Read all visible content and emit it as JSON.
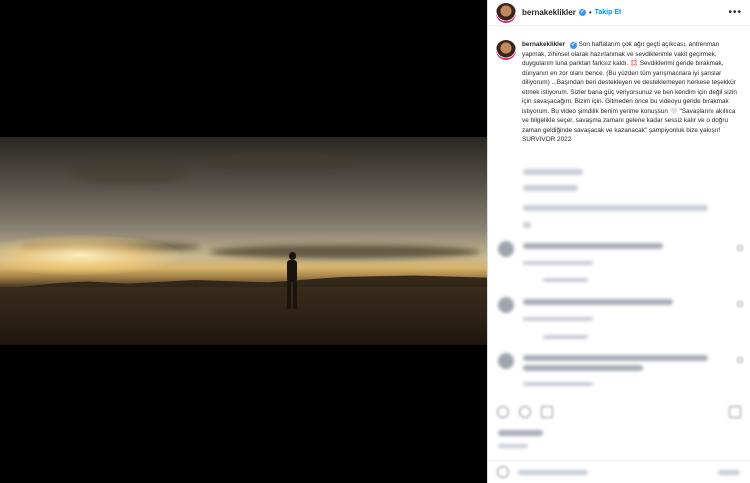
{
  "post": {
    "username": "bernakeklikler",
    "verified_badge": "✔",
    "separator": "•",
    "follow_label": "Takip Et",
    "more_label": "•••",
    "caption": "Son haftalarım çok ağır geçti açıkcası, antrenman yapmak, zihinsel olarak hazırlanmak ve sevdiklerimle vakit geçirmek, duygularım luna parktan farksız kaldı. 💢 Sevdiklerimi geride bırakmak, dünyanın en zor olanı bence. (Bu yüzden tüm yarışmacılara iyi şanslar diliyorum) ...Başından beri destekleyen ve desteklemeyen herkese teşekkür etmek istiyorum. Sizler bana güç veriyorsunuz ve ben kendim için değil sizin için savaşacağım. Bizim için. Gitmeden önce bu videoyu geride bırakmak istiyorum. Bu video şimdilik benim yerime konuşsun 🤍 \"Savaşlarını akıllıca ve bilgelikle seçer, savaşma zamanı gelene kadar sessiz kalır ve o doğru zaman geldiğinde savaşacak ve kazanacak\" şampiyonluk bize yakışır! SURVIVOR 2022"
  },
  "colors": {
    "accent": "#0095f6",
    "verified": "#3897f0",
    "text": "#262626",
    "border": "#dbdbdb"
  },
  "icons": {
    "more": "ellipsis-icon",
    "like": "heart-icon",
    "comment": "comment-icon",
    "share": "share-icon",
    "save": "bookmark-icon"
  }
}
